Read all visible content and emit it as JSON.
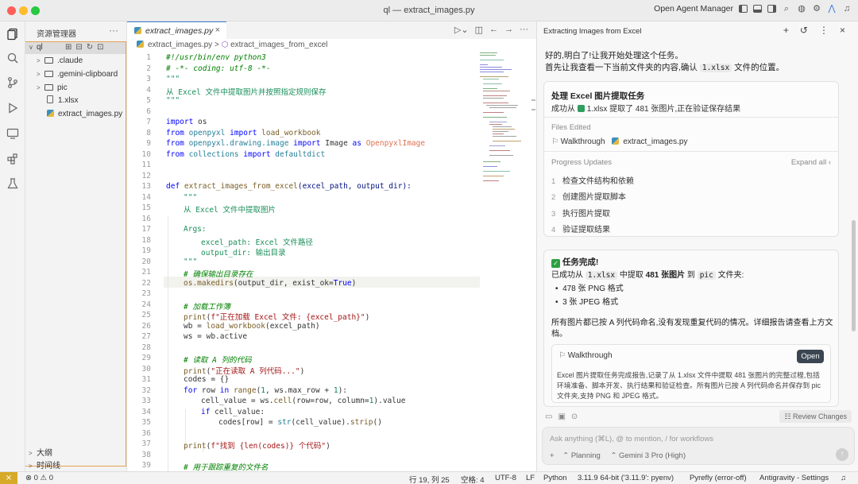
{
  "window": {
    "title": "ql — extract_images.py",
    "open_agent_manager": "Open Agent Manager"
  },
  "explorer": {
    "header": "资源管理器",
    "root": "ql",
    "items": [
      ".claude",
      ".gemini-clipboard",
      "pic",
      "1.xlsx",
      "extract_images.py"
    ],
    "outline": "大纲",
    "timeline": "时间线"
  },
  "editor": {
    "tab": "extract_images.py",
    "breadcrumb_file": "extract_images.py",
    "breadcrumb_symbol": "extract_images_from_excel",
    "line_numbers": [
      "1",
      "2",
      "3",
      "4",
      "5",
      "6",
      "7",
      "8",
      "9",
      "10",
      "11",
      "12",
      "13",
      "14",
      "15",
      "16",
      "17",
      "18",
      "19",
      "20",
      "21",
      "22",
      "23",
      "24",
      "25",
      "26",
      "27",
      "28",
      "29",
      "30",
      "31",
      "32",
      "33",
      "34",
      "35",
      "36",
      "37",
      "38",
      "39"
    ],
    "lines": {
      "l1": "#!/usr/bin/env python3",
      "l2": "# -*- coding: utf-8 -*-",
      "l3": "\"\"\"",
      "l4": "从 Excel 文件中提取图片并按照指定规则保存",
      "l5": "\"\"\"",
      "l7a": "import",
      "l7b": " os",
      "l8a": "from",
      "l8b": " openpyxl ",
      "l8c": "import",
      "l8d": " load_workbook",
      "l9a": "from",
      "l9b": " openpyxl.drawing.image ",
      "l9c": "import",
      "l9d": " Image ",
      "l9e": "as",
      "l9f": " OpenpyxlImage",
      "l10a": "from",
      "l10b": " collections ",
      "l10c": "import",
      "l10d": " defaultdict",
      "l13a": "def",
      "l13b": " extract_images_from_excel",
      "l13c": "(excel_path, output_dir):",
      "l14": "\"\"\"",
      "l15": "从 Excel 文件中提取图片",
      "l17": "Args:",
      "l18": "excel_path: Excel 文件路径",
      "l19": "output_dir: 输出目录",
      "l20": "\"\"\"",
      "l21": "# 确保输出目录存在",
      "l22a": "os.makedirs",
      "l22b": "(output_dir, exist_ok=",
      "l22c": "True",
      "l22d": ")",
      "l24": "# 加载工作簿",
      "l25a": "print",
      "l25b": "(",
      "l25c": "f\"正在加载 Excel 文件: {excel_path}\"",
      "l25d": ")",
      "l26a": "wb = ",
      "l26b": "load_workbook",
      "l26c": "(excel_path)",
      "l27": "ws = wb.active",
      "l29": "# 读取 A 列的代码",
      "l30a": "print",
      "l30b": "(",
      "l30c": "\"正在读取 A 列代码...\"",
      "l30d": ")",
      "l31": "codes = {}",
      "l32a": "for",
      "l32b": " row ",
      "l32c": "in",
      "l32d": " range",
      "l32e": "(",
      "l32f": "1",
      "l32g": ", ws.max_row + ",
      "l32h": "1",
      "l32i": "):",
      "l33a": "cell_value = ws.",
      "l33b": "cell",
      "l33c": "(row=row, column=",
      "l33d": "1",
      "l33e": ").value",
      "l34a": "if",
      "l34b": " cell_value:",
      "l35a": "codes[row] = ",
      "l35b": "str",
      "l35c": "(cell_value).",
      "l35d": "strip",
      "l35e": "()",
      "l37a": "print",
      "l37b": "(",
      "l37c": "f\"找到 {len(codes)} 个代码\"",
      "l37d": ")",
      "l39": "# 用于跟踪重复的文件名"
    }
  },
  "agent": {
    "title": "Extracting Images from Excel",
    "intro1": "好的,明白了!让我开始处理这个任务。",
    "intro2a": "首先让我查看一下当前文件夹的内容,确认",
    "intro2b": "1.xlsx",
    "intro2c": "文件的位置。",
    "task_title": "处理 Excel 图片提取任务",
    "task_status_a": "成功从",
    "task_status_file": "1.xlsx",
    "task_status_b": "提取了 481 张图片,正在验证保存结果",
    "files_edited": "Files Edited",
    "file1": "Walkthrough",
    "file2": "extract_images.py",
    "progress_updates": "Progress Updates",
    "expand_all": "Expand all",
    "steps": [
      {
        "n": "1",
        "label": "检查文件结构和依赖"
      },
      {
        "n": "2",
        "label": "创建图片提取脚本"
      },
      {
        "n": "3",
        "label": "执行图片提取"
      },
      {
        "n": "4",
        "label": "验证提取结果"
      }
    ],
    "done_title": "任务完成!",
    "done_a": "已成功从",
    "done_file": "1.xlsx",
    "done_b": "中提取",
    "done_count": "481 张图片",
    "done_c": "到",
    "done_dir": "pic",
    "done_d": "文件夹:",
    "bullets": [
      "478 张 PNG 格式",
      "3 张 JPEG 格式"
    ],
    "summary1": "所有图片都已按 A 列代码命名,没有发现重复代码的情况。详细报告请查看上方文",
    "summary2": "档。",
    "walkthrough_title": "Walkthrough",
    "open_button": "Open",
    "walk_desc1": "Excel 图片提取任务完成报告,记录了从 1.xlsx 文件中提取 481 张图片的完整过程,包括",
    "walk_desc2": "环境准备、脚本开发、执行结果和验证检查。所有图片已按 A 列代码命名并保存到 pic",
    "walk_desc3": "文件夹,支持 PNG 和 JPEG 格式。",
    "review_changes": "Review Changes",
    "input_placeholder": "Ask anything (⌘L), @ to mention, / for workflows",
    "mode": "Planning",
    "model": "Gemini 3 Pro (High)"
  },
  "status": {
    "errors": "0",
    "warnings": "0",
    "position": "行 19, 列 25",
    "spaces": "空格: 4",
    "encoding": "UTF-8",
    "eol": "LF",
    "language": "Python",
    "interpreter": "3.11.9 64-bit ('3.11.9': pyenv)",
    "linter": "Pyrefly (error-off)",
    "settings": "Antigravity - Settings"
  },
  "colors": {
    "accent": "#3a7fd0",
    "keyword": "#0000ff",
    "string": "#a31515",
    "comment": "#008000",
    "remote": "#d7a928"
  }
}
